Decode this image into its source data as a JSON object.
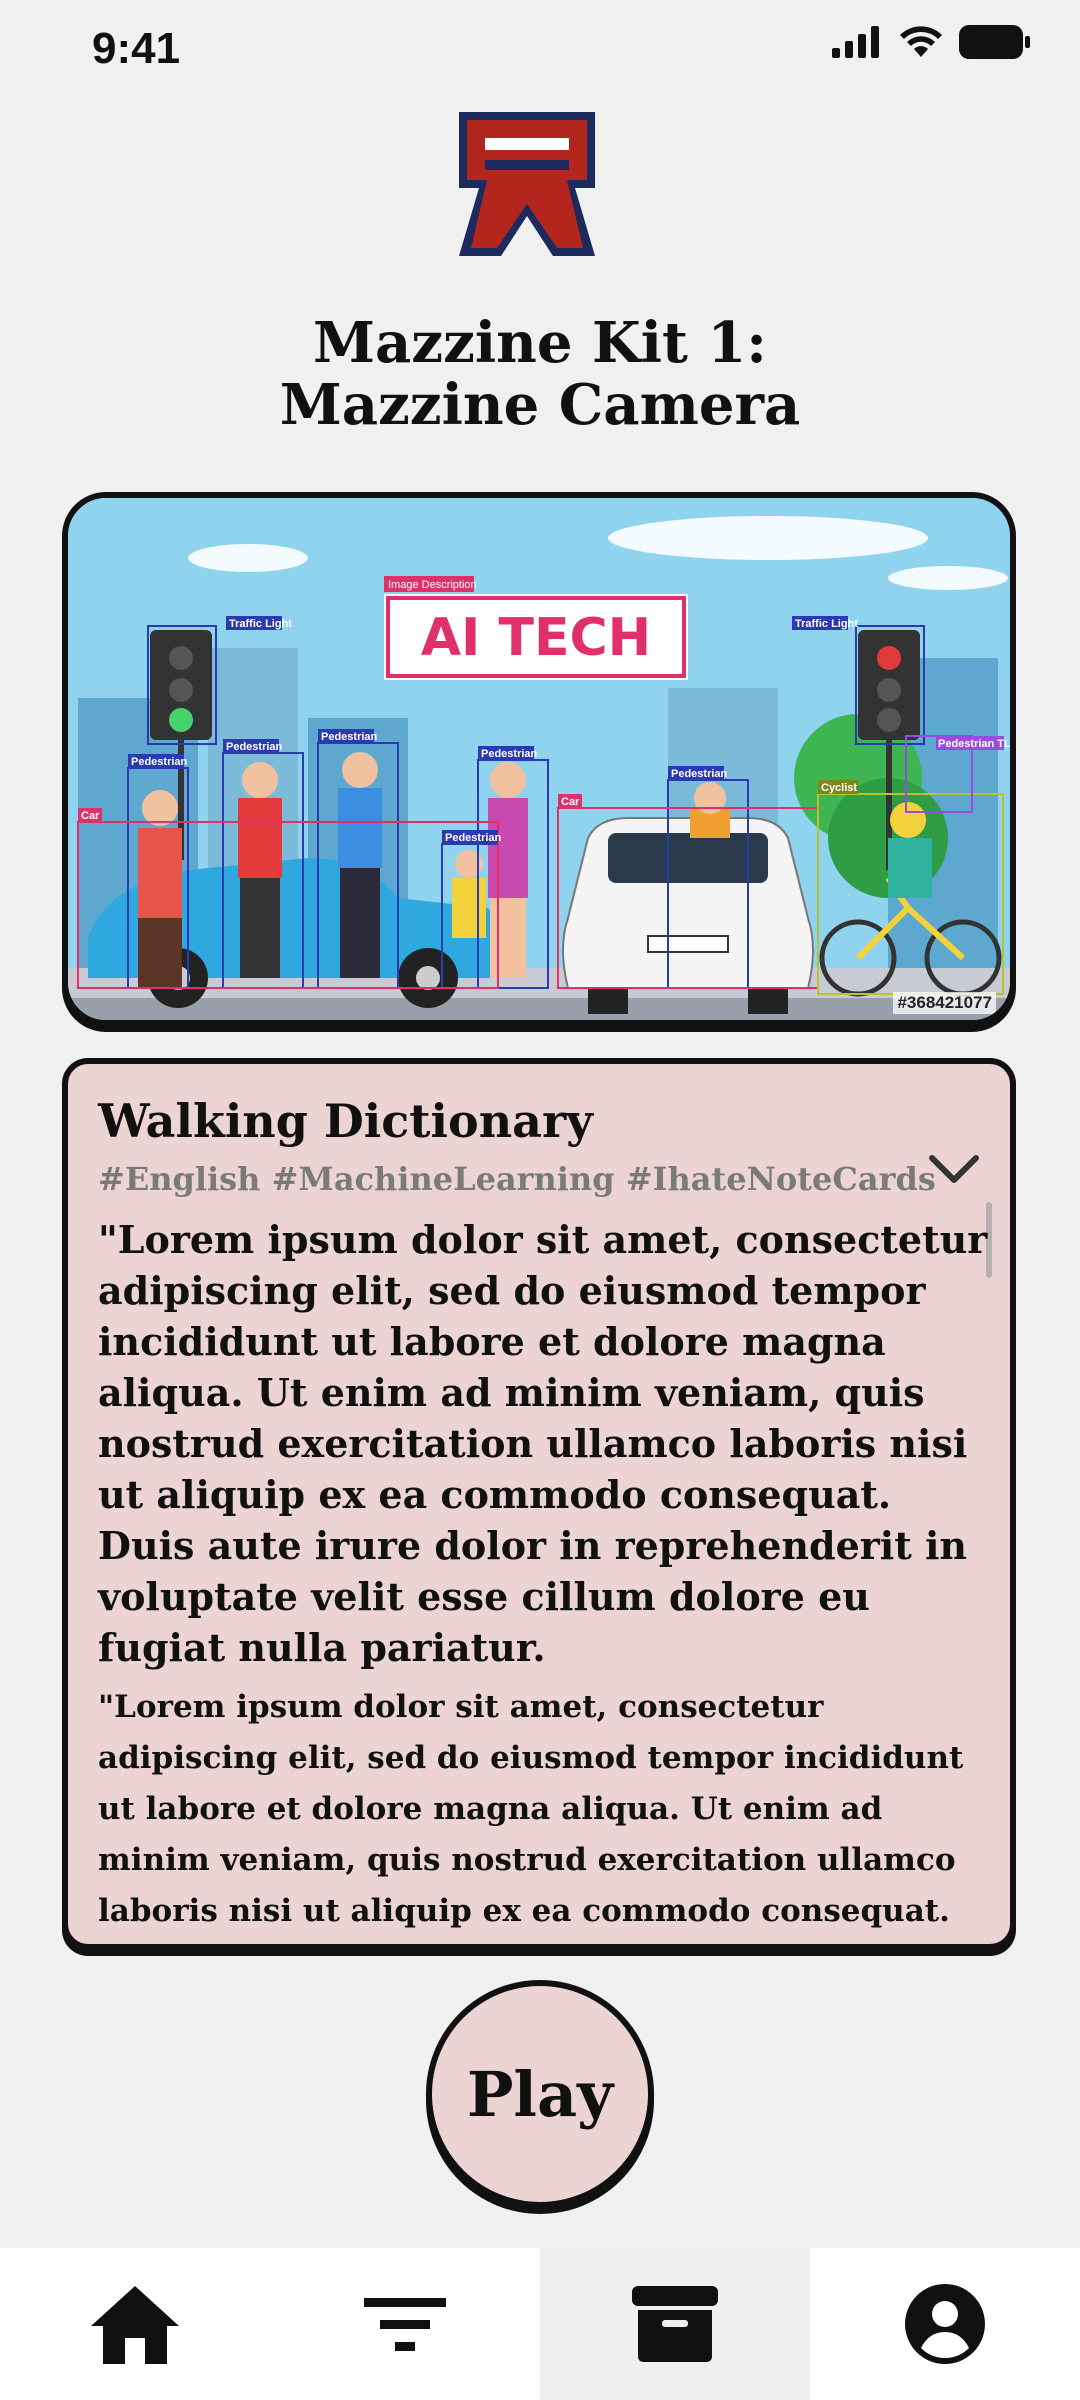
{
  "status_bar": {
    "time": "9:41"
  },
  "header": {
    "title_line1": "Mazzine Kit 1:",
    "title_line2": "Mazzine Camera"
  },
  "image": {
    "banner_text": "AI TECH",
    "banner_label": "Image Description",
    "stock_id": "#368421077",
    "detections": [
      "Traffic Light",
      "Traffic Light",
      "Pedestrian",
      "Pedestrian",
      "Pedestrian",
      "Pedestrian",
      "Pedestrian",
      "Pedestrian",
      "Car",
      "Car",
      "Cyclist",
      "Pedestrian TL"
    ]
  },
  "dictionary": {
    "title": "Walking Dictionary",
    "tags": "#English #MachineLearning #IhateNoteCards",
    "body_large": "\"Lorem ipsum dolor sit amet, consectetur adipiscing elit, sed do eiusmod tempor incididunt ut labore et dolore magna aliqua. Ut enim ad minim veniam, quis nostrud exercitation ullamco laboris nisi ut aliquip ex ea commodo consequat. Duis aute irure dolor in reprehenderit in voluptate velit esse cillum dolore eu fugiat nulla pariatur.",
    "body_small": "\"Lorem ipsum dolor sit amet, consectetur adipiscing elit, sed do eiusmod tempor incididunt ut labore et dolore magna aliqua. Ut enim ad minim veniam, quis nostrud exercitation ullamco laboris nisi ut aliquip ex ea commodo consequat."
  },
  "play_button": {
    "label": "Play"
  },
  "nav": {
    "items": [
      {
        "icon": "home-icon"
      },
      {
        "icon": "filter-icon"
      },
      {
        "icon": "archive-icon",
        "active": true
      },
      {
        "icon": "account-icon"
      }
    ]
  },
  "colors": {
    "background": "#f0f0f0",
    "card_pink": "#ecd4d5",
    "logo_red": "#b3261e",
    "logo_navy": "#1c2a5e",
    "banner_pink": "#e0306a",
    "tag_gray": "#7a7a7a"
  }
}
